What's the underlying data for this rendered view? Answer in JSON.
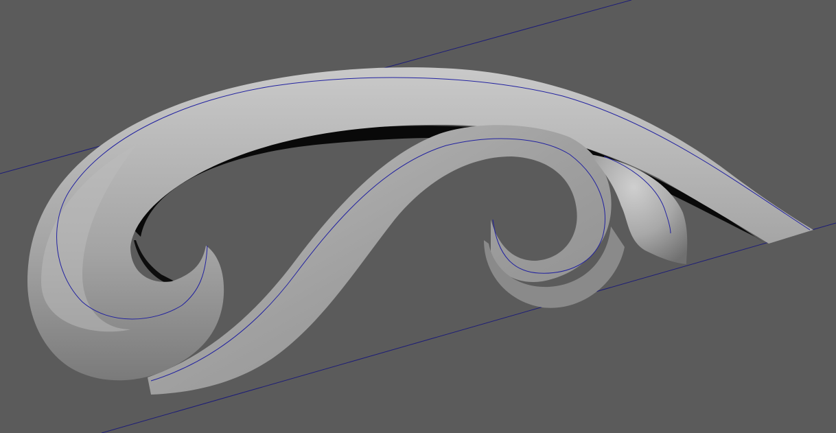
{
  "viewport": {
    "background_color": "#5b5b5b",
    "grid_line_color": "#1c1c78",
    "curve_color": "#2020a0",
    "surface_light_color": "#c8c8c8",
    "surface_mid_color": "#a6a6a6",
    "surface_dark_color": "#6e6e6e",
    "shadow_color": "#000000"
  }
}
